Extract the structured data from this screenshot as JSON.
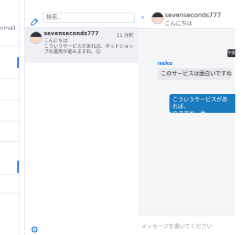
{
  "left": {
    "partial_text": "nmail."
  },
  "list": {
    "search_placeholder": "検索...",
    "conversations": [
      {
        "name": "sevenseconds777",
        "time": "11 分前",
        "preview": "こんにちは\nこういうサービスがあれば、ネットショップの運用が進みますね。😊"
      }
    ]
  },
  "chat": {
    "title": "sevenseconds777",
    "subtitle": "こんにちは",
    "time_chip": "午後",
    "messages": [
      {
        "direction": "in",
        "sender": "neko",
        "text": "このサービスは面白いですね🥰"
      },
      {
        "direction": "out",
        "sender": "",
        "text": "こういうサービスがあれば、\nりますね。😍"
      }
    ],
    "composer_placeholder": "メッセージを書いてください"
  },
  "icons": {
    "compose": "compose-icon",
    "settings": "gear-icon",
    "back": "chevron-left-icon",
    "avatar": "avatar"
  },
  "colors": {
    "accent": "#2d7be5",
    "outgoing_bubble": "#1a7bbf",
    "incoming_bubble": "#e8e9ec",
    "selected_row": "#eef0f4"
  }
}
